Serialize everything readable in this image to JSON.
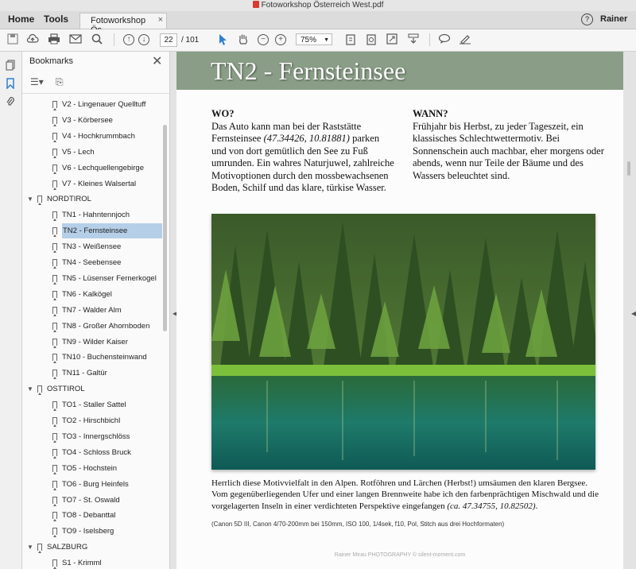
{
  "window": {
    "title": "Fotoworkshop Österreich West.pdf"
  },
  "nav": {
    "home": "Home",
    "tools": "Tools"
  },
  "doc_tab": {
    "label": "Fotoworkshop Ös...",
    "close": "×"
  },
  "user": {
    "name": "Rainer",
    "help": "?"
  },
  "toolbar": {
    "page_current": "22",
    "page_total": "/ 101",
    "zoom": "75%"
  },
  "bookmarks": {
    "title": "Bookmarks",
    "items": [
      {
        "label": "V2 - Lingenauer Quelltuff",
        "level": 1
      },
      {
        "label": "V3 - Körbersee",
        "level": 1
      },
      {
        "label": "V4 - Hochkrummbach",
        "level": 1
      },
      {
        "label": "V5 - Lech",
        "level": 1
      },
      {
        "label": "V6 - Lechquellengebirge",
        "level": 1
      },
      {
        "label": "V7 - Kleines Walsertal",
        "level": 1
      },
      {
        "label": "NORDTIROL",
        "level": 0
      },
      {
        "label": "TN1 - Hahntennjoch",
        "level": 1
      },
      {
        "label": "TN2 - Fernsteinsee",
        "level": 1,
        "selected": true
      },
      {
        "label": "TN3 - Weißensee",
        "level": 1
      },
      {
        "label": "TN4 - Seebensee",
        "level": 1
      },
      {
        "label": "TN5 - Lüsenser Fernerkogel",
        "level": 1
      },
      {
        "label": "TN6 - Kalkögel",
        "level": 1
      },
      {
        "label": "TN7 - Walder Alm",
        "level": 1
      },
      {
        "label": "TN8 - Großer Ahornboden",
        "level": 1
      },
      {
        "label": "TN9 - Wilder Kaiser",
        "level": 1
      },
      {
        "label": "TN10 - Buchensteinwand",
        "level": 1
      },
      {
        "label": "TN11 - Galtür",
        "level": 1
      },
      {
        "label": "OSTTIROL",
        "level": 0
      },
      {
        "label": "TO1 - Staller Sattel",
        "level": 1
      },
      {
        "label": "TO2 - Hirschbichl",
        "level": 1
      },
      {
        "label": "TO3 - Innergschlöss",
        "level": 1
      },
      {
        "label": "TO4 - Schloss Bruck",
        "level": 1
      },
      {
        "label": "TO5 - Hochstein",
        "level": 1
      },
      {
        "label": "TO6 - Burg Heinfels",
        "level": 1
      },
      {
        "label": "TO7 - St. Oswald",
        "level": 1
      },
      {
        "label": "TO8 - Debanttal",
        "level": 1
      },
      {
        "label": "TO9 - Iselsberg",
        "level": 1
      },
      {
        "label": "SALZBURG",
        "level": 0
      },
      {
        "label": "S1 - Krimml",
        "level": 1
      }
    ]
  },
  "page": {
    "title": "TN2 - Fernsteinsee",
    "wo_heading": "WO?",
    "wo_text_a": "Das Auto kann man bei der Raststätte Fernsteinsee ",
    "wo_coords": "(47.34426, 10.81881)",
    "wo_text_b": " parken und von dort gemütlich den See zu Fuß umrunden. Ein wahres Naturjuwel, zahlreiche Motivoptionen durch den mossbewachsenen Boden, Schilf und das klare, türkise Wasser.",
    "wann_heading": "WANN?",
    "wann_text": "Frühjahr bis Herbst, zu jeder Tageszeit, ein klassisches Schlechtwettermotiv. Bei Sonnenschein auch machbar, eher morgens oder abends, wenn nur Teile der Bäume und des Wassers beleuchtet sind.",
    "caption_a": "Herrlich diese Motivvielfalt in den Alpen. Rotföhren und Lärchen (Herbst!) umsäumen den klaren Bergsee. Vom gegenüberliegenden Ufer und einer langen Brennweite habe ich den farbenprächtigen Mischwald und die vorgelagerten Inseln in einer verdichteten Perspektive eingefangen ",
    "caption_coords": "(ca. 47.34755, 10.82502)",
    "caption_end": ".",
    "tech": "(Canon 5D III, Canon 4/70-200mm bei 150mm, ISO 100, 1/4sek, f10, Pol, Stitch aus drei Hochformaten)",
    "footer": "Rainer Mirau PHOTOGRAPHY © silent-moment.com"
  },
  "colors": {
    "banner": "#8a9e87",
    "selection": "#b5cfe8",
    "accent_blue": "#2f7fd6"
  }
}
